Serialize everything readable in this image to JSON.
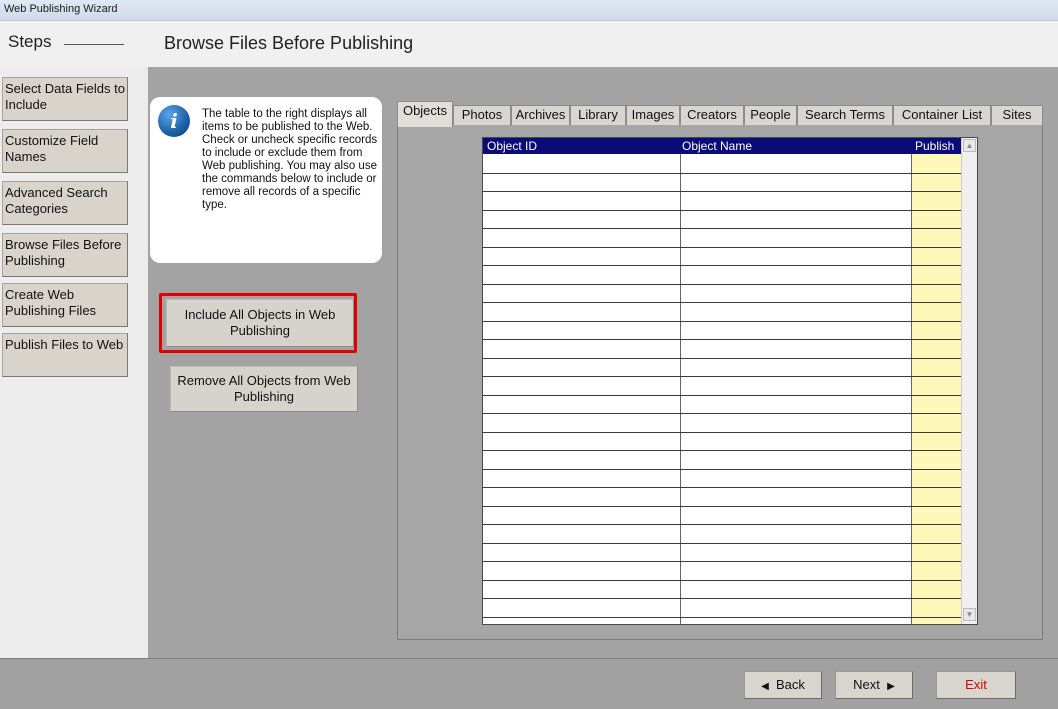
{
  "window": {
    "title": "Web Publishing Wizard"
  },
  "steps": {
    "label": "Steps",
    "items": [
      "Select Data Fields to Include",
      "Customize Field Names",
      "Advanced Search Categories",
      "Browse Files Before Publishing",
      "Create Web Publishing Files",
      "Publish Files to Web"
    ]
  },
  "page": {
    "title": "Browse Files Before Publishing"
  },
  "info": {
    "icon": "info-icon",
    "text": "The table to the right displays all items to be published to the Web.  Check or uncheck specific records to include or exclude them from Web publishing.  You may also use the commands below to include or remove all records of a specific type."
  },
  "actions": {
    "include_all": "Include All Objects in Web Publishing",
    "remove_all": "Remove All Objects from Web Publishing",
    "highlight_color": "#e00000"
  },
  "tabs": [
    "Objects",
    "Photos",
    "Archives",
    "Library",
    "Images",
    "Creators",
    "People",
    "Search Terms",
    "Container List",
    "Sites"
  ],
  "active_tab": "Objects",
  "table": {
    "columns": [
      "Object ID",
      "Object Name",
      "Publish"
    ],
    "rows": []
  },
  "footer": {
    "back": "Back",
    "next": "Next",
    "exit": "Exit",
    "exit_color": "#d40000"
  },
  "colors": {
    "header_bg": "#0a0a78",
    "publish_col": "#fdf8b7",
    "panel_bg": "#a3a3a3"
  }
}
